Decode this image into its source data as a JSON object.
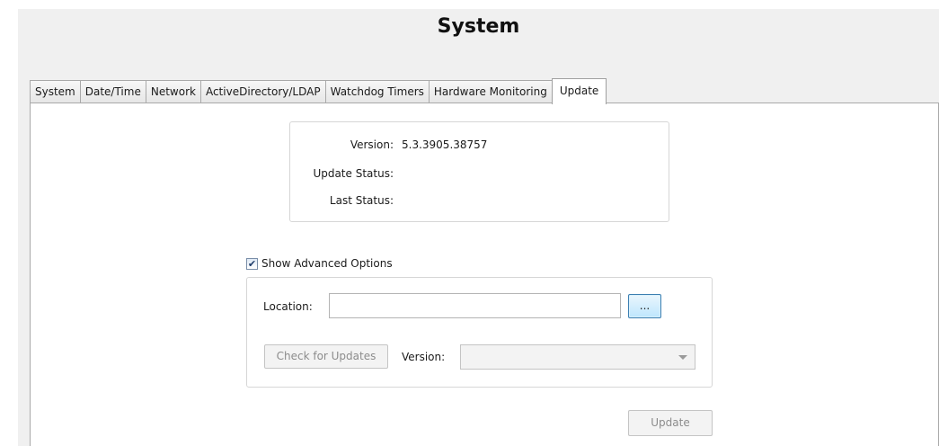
{
  "window": {
    "title": "System"
  },
  "tabs": [
    {
      "label": "System"
    },
    {
      "label": "Date/Time"
    },
    {
      "label": "Network"
    },
    {
      "label": "ActiveDirectory/LDAP"
    },
    {
      "label": "Watchdog Timers"
    },
    {
      "label": "Hardware Monitoring"
    },
    {
      "label": "Update",
      "active": true
    }
  ],
  "info": {
    "version_label": "Version:",
    "version_value": "5.3.3905.38757",
    "update_status_label": "Update Status:",
    "update_status_value": "",
    "last_status_label": "Last Status:",
    "last_status_value": ""
  },
  "advanced": {
    "checkbox_label": "Show Advanced Options",
    "checked": true,
    "location_label": "Location:",
    "location_value": "",
    "browse_label": "...",
    "check_button_label": "Check for Updates",
    "version_label": "Version:",
    "version_selected": ""
  },
  "update_button_label": "Update",
  "icons": {
    "checkbox_check": "check-icon",
    "combo_arrow": "chevron-down-icon"
  }
}
